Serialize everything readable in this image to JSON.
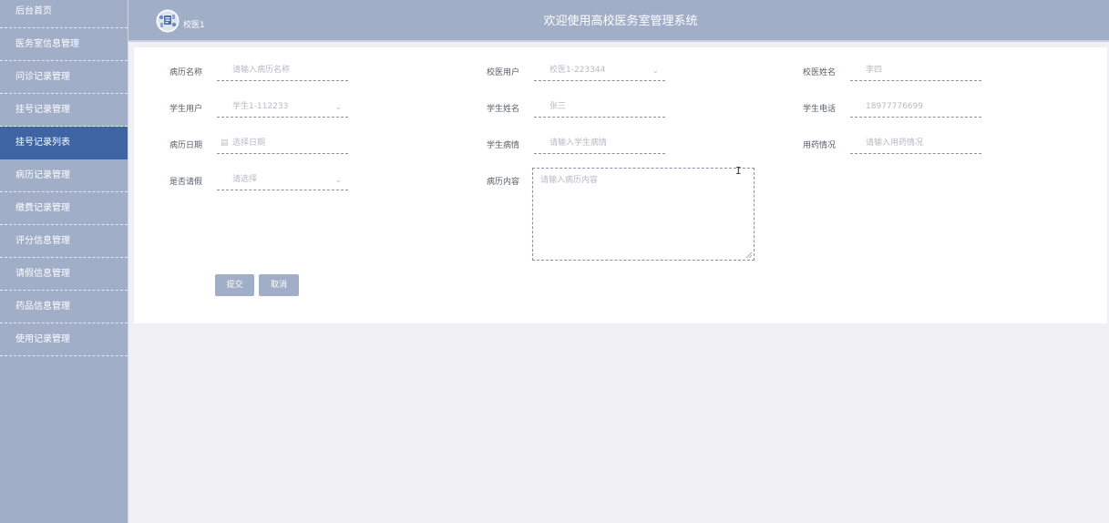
{
  "sidebar": {
    "items": [
      {
        "label": "后台首页"
      },
      {
        "label": "医务室信息管理"
      },
      {
        "label": "问诊记录管理"
      },
      {
        "label": "挂号记录管理"
      },
      {
        "label": "挂号记录列表"
      },
      {
        "label": "病历记录管理"
      },
      {
        "label": "缴费记录管理"
      },
      {
        "label": "评分信息管理"
      },
      {
        "label": "请假信息管理"
      },
      {
        "label": "药品信息管理"
      },
      {
        "label": "使用记录管理"
      }
    ],
    "active_index": 4
  },
  "header": {
    "site_name": "校医1",
    "title": "欢迎使用高校医务室管理系统"
  },
  "form": {
    "record_name": {
      "label": "病历名称",
      "placeholder": "请输入病历名称"
    },
    "doctor_user": {
      "label": "校医用户",
      "value": "校医1-223344"
    },
    "doctor_name": {
      "label": "校医姓名",
      "value": "李四"
    },
    "student_user": {
      "label": "学生用户",
      "value": "学生1-112233"
    },
    "student_name": {
      "label": "学生姓名",
      "value": "张三"
    },
    "student_phone": {
      "label": "学生电话",
      "value": "18977776699"
    },
    "record_date": {
      "label": "病历日期",
      "placeholder": "选择日期"
    },
    "student_condition": {
      "label": "学生病情",
      "placeholder": "请输入学生病情"
    },
    "medication": {
      "label": "用药情况",
      "placeholder": "请输入用药情况"
    },
    "leave": {
      "label": "是否请假",
      "placeholder": "请选择"
    },
    "record_content": {
      "label": "病历内容",
      "placeholder": "请输入病历内容"
    },
    "submit_label": "提交",
    "cancel_label": "取消"
  },
  "colors": {
    "sidebar_bg": "#a0aec8",
    "active_bg": "#3e64a4",
    "page_bg": "#efeff4"
  }
}
